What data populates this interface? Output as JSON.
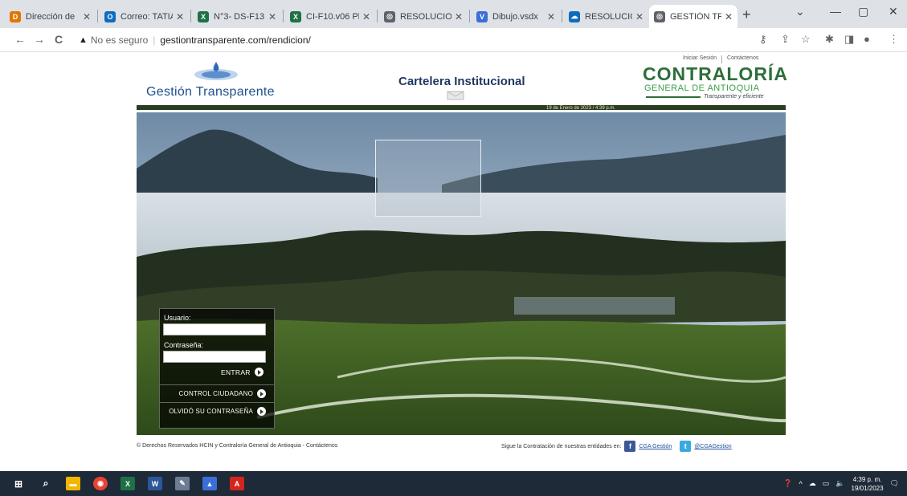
{
  "browser": {
    "tabs": [
      {
        "title": "Dirección de",
        "color": "#e37400",
        "glyph": "D"
      },
      {
        "title": "Correo: TATIA",
        "color": "#0f6cbd",
        "glyph": "O"
      },
      {
        "title": "N°3- DS-F13",
        "color": "#1e7145",
        "glyph": "X"
      },
      {
        "title": "CI-F10.v06 Pl",
        "color": "#1e7145",
        "glyph": "X"
      },
      {
        "title": "RESOLUCION",
        "color": "#5f6368",
        "glyph": "◎"
      },
      {
        "title": "Dibujo.vsdx",
        "color": "#3a6fd8",
        "glyph": "V"
      },
      {
        "title": "RESOLUCION",
        "color": "#0f6cbd",
        "glyph": "☁"
      },
      {
        "title": "GESTIÓN TRA",
        "color": "#5f6368",
        "glyph": "◎"
      }
    ],
    "close_glyph": "✕",
    "new_tab": "+",
    "window_controls": [
      "⌄",
      "—",
      "▢",
      "✕"
    ],
    "address": {
      "security_label": "No es seguro",
      "url": "gestiontransparente.com/rendicion/"
    },
    "nav": {
      "back": "←",
      "forward": "→",
      "reload": "C"
    }
  },
  "header": {
    "logo_text": "Gestión Transparente",
    "cartelera": "Cartelera Institucional",
    "links": [
      "Iniciar Sesión",
      "Contáctenos"
    ],
    "org_title": "CONTRALORÍA",
    "org_subtitle": "GENERAL DE ANTIOQUIA",
    "org_slogan": "Transparente y eficiente",
    "date_text": "19 de Enero de 2023 / 4:39 p.m."
  },
  "login": {
    "user_label": "Usuario:",
    "user_value": "",
    "password_label": "Contraseña:",
    "password_value": "",
    "enter_label": "ENTRAR",
    "citizen_label": "CONTROL CIUDADANO",
    "forgot_label": "OLVIDÓ SU CONTRASEÑA"
  },
  "footer": {
    "rights": "© Derechos Reservados HCIN y Contraloría General de Antioquia - Contáctenos",
    "follow": "Sigue la Contratación de nuestras entidades en:",
    "facebook": "CGA Gestión",
    "twitter": "@CGAGestion"
  },
  "taskbar": {
    "time": "4:39 p. m.",
    "date": "19/01/2023",
    "apps": [
      {
        "name": "file-explorer",
        "color": "#f2b600",
        "glyph": "▬"
      },
      {
        "name": "chrome",
        "color": "#e94235",
        "glyph": "◉"
      },
      {
        "name": "excel",
        "color": "#1e7145",
        "glyph": "X"
      },
      {
        "name": "word",
        "color": "#2b579a",
        "glyph": "W"
      },
      {
        "name": "paint",
        "color": "#6b7c93",
        "glyph": "✎"
      },
      {
        "name": "app-6",
        "color": "#3a6fd8",
        "glyph": "▲"
      },
      {
        "name": "acrobat",
        "color": "#d4251c",
        "glyph": "A"
      }
    ]
  }
}
